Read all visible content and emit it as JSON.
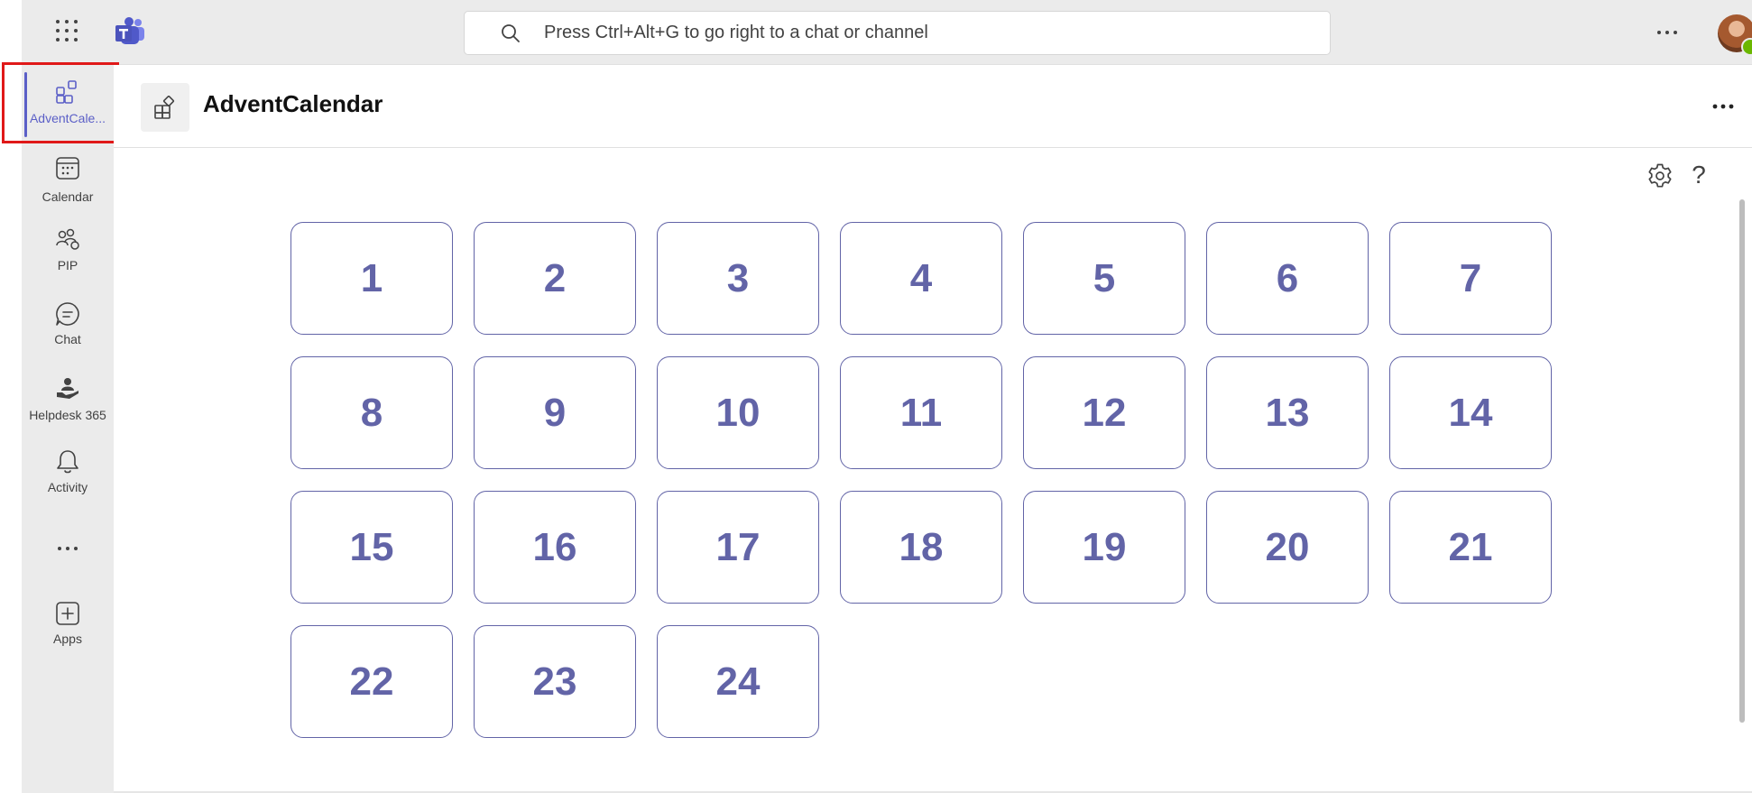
{
  "topbar": {
    "search_placeholder": "Press Ctrl+Alt+G to go right to a chat or channel"
  },
  "sidebar": {
    "items": [
      {
        "label": "AdventCale...",
        "icon": "apps-grid-icon",
        "active": true
      },
      {
        "label": "Calendar",
        "icon": "calendar-icon"
      },
      {
        "label": "PIP",
        "icon": "people-icon"
      },
      {
        "label": "Chat",
        "icon": "chat-icon"
      },
      {
        "label": "Helpdesk 365",
        "icon": "helpdesk-icon"
      },
      {
        "label": "Activity",
        "icon": "bell-icon"
      },
      {
        "label": "",
        "icon": "more-icon"
      },
      {
        "label": "Apps",
        "icon": "add-apps-icon"
      }
    ]
  },
  "header": {
    "title": "AdventCalendar"
  },
  "calendar": {
    "days": [
      "1",
      "2",
      "3",
      "4",
      "5",
      "6",
      "7",
      "8",
      "9",
      "10",
      "11",
      "12",
      "13",
      "14",
      "15",
      "16",
      "17",
      "18",
      "19",
      "20",
      "21",
      "22",
      "23",
      "24"
    ]
  },
  "colors": {
    "accent": "#5b5fc7",
    "tile_border": "#6264a7",
    "tile_text": "#6264a7",
    "highlight": "#e01919",
    "presence": "#6bb700"
  }
}
